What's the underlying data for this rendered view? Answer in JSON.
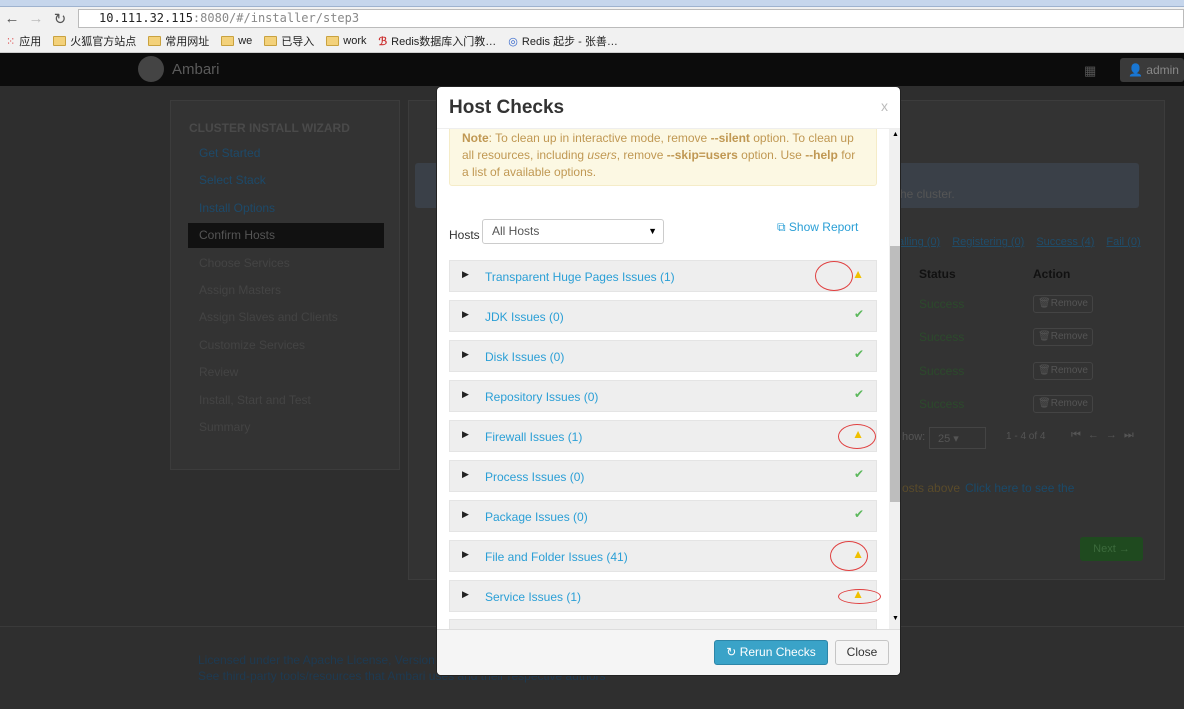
{
  "browser": {
    "url_host": "10.111.32.115",
    "url_rest": ":8080/#/installer/step3",
    "bookmarks": [
      "应用",
      "火狐官方站点",
      "常用网址",
      "we",
      "已导入",
      "work",
      "Redis数据库入门教…",
      "Redis 起步 - 张善…"
    ]
  },
  "navbar": {
    "brand": "Ambari",
    "user": "admin"
  },
  "sidebar": {
    "title": "CLUSTER INSTALL WIZARD",
    "steps": [
      "Get Started",
      "Select Stack",
      "Install Options",
      "Confirm Hosts",
      "Choose Services",
      "Assign Masters",
      "Assign Slaves and Clients",
      "Customize Services",
      "Review",
      "Install, Start and Test",
      "Summary"
    ],
    "active": 3
  },
  "main": {
    "info_text": "he cluster.",
    "filters": [
      "alling (0)",
      "Registering (0)",
      "Success (4)",
      "Fail (0)"
    ],
    "col_status": "Status",
    "col_action": "Action",
    "rows": [
      {
        "status": "Success",
        "action": "Remove"
      },
      {
        "status": "Success",
        "action": "Remove"
      },
      {
        "status": "Success",
        "action": "Remove"
      },
      {
        "status": "Success",
        "action": "Remove"
      }
    ],
    "show_label": "how:",
    "show_value": "25",
    "range": "1 - 4 of 4",
    "warn_text": "osts above",
    "warn_link": "Click here to see the",
    "next": "Next →"
  },
  "footer": {
    "line1": "Licensed under the Apache License, Version",
    "line2": "See third-party tools/resources that Ambari uses and their respective authors"
  },
  "modal": {
    "title": "Host Checks",
    "close": "x",
    "note": {
      "label": "Note",
      "t1": ": To clean up in interactive mode, remove ",
      "b1": "--silent",
      "t2": " option. To clean up all resources, including ",
      "i1": "users",
      "t3": ", remove ",
      "b2": "--skip=users",
      "t4": " option. Use ",
      "b3": "--help",
      "t5": " for a list of available options."
    },
    "hosts_label": "Hosts",
    "hosts_value": "All Hosts",
    "show_report": "Show Report",
    "checks": [
      {
        "label": "Transparent Huge Pages Issues (1)",
        "status": "warning"
      },
      {
        "label": "JDK Issues (0)",
        "status": "ok"
      },
      {
        "label": "Disk Issues (0)",
        "status": "ok"
      },
      {
        "label": "Repository Issues (0)",
        "status": "ok"
      },
      {
        "label": "Firewall Issues (1)",
        "status": "warning"
      },
      {
        "label": "Process Issues (0)",
        "status": "ok"
      },
      {
        "label": "Package Issues (0)",
        "status": "ok"
      },
      {
        "label": "File and Folder Issues (41)",
        "status": "warning"
      },
      {
        "label": "Service Issues (1)",
        "status": "warning"
      }
    ],
    "rerun": "Rerun Checks",
    "close_button": "Close"
  }
}
